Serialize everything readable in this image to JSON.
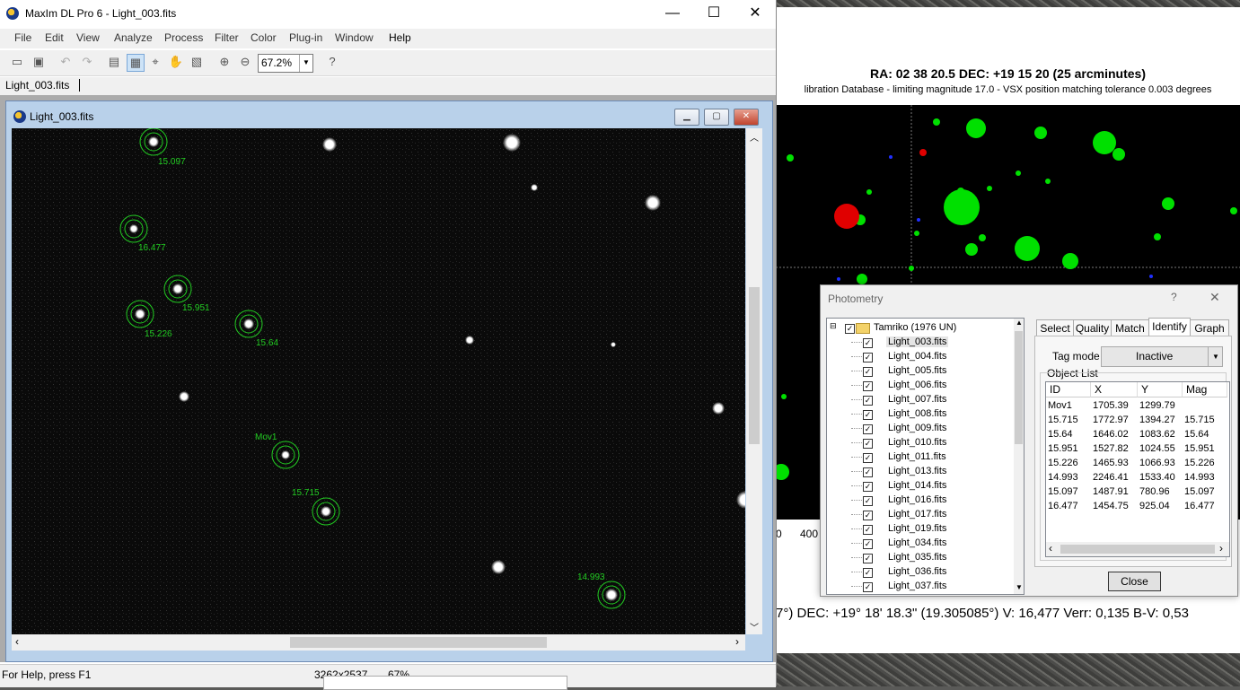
{
  "main": {
    "title": "MaxIm DL Pro 6 - Light_003.fits",
    "controls": {
      "minimize": "—",
      "maximize": "☐",
      "close": "✕"
    },
    "menu": [
      "File",
      "Edit",
      "View",
      "Analyze",
      "Process",
      "Filter",
      "Color",
      "Plug-in",
      "Window",
      "Help"
    ],
    "zoom": "67.2%",
    "doc_tab": "Light_003.fits"
  },
  "image_window": {
    "title": "Light_003.fits",
    "labels": [
      {
        "text": "15.097"
      },
      {
        "text": "16.477"
      },
      {
        "text": "15.951"
      },
      {
        "text": "15.226"
      },
      {
        "text": "15.64"
      },
      {
        "text": "Mov1"
      },
      {
        "text": "15.715"
      },
      {
        "text": "14.993"
      }
    ]
  },
  "status": {
    "help": "For Help, press F1",
    "dims": "3262x2537",
    "zoom": "67%"
  },
  "chart": {
    "title": "RA: 02 38 20.5   DEC: +19 15 20 (25 arcminutes)",
    "subtitle": "libration Database - limiting magnitude 17.0 - VSX position matching tolerance 0.003 degrees",
    "axis_labels": [
      "0",
      "400"
    ],
    "readout": "7°)   DEC: +19° 18' 18.3\" (19.305085°)   V: 16,477   Verr: 0,135   B-V: 0,53"
  },
  "photometry": {
    "title": "Photometry",
    "help_btn": "?",
    "close_x": "✕",
    "tree_root": "Tamriko (1976 UN)",
    "files": [
      "Light_003.fits",
      "Light_004.fits",
      "Light_005.fits",
      "Light_006.fits",
      "Light_007.fits",
      "Light_008.fits",
      "Light_009.fits",
      "Light_010.fits",
      "Light_011.fits",
      "Light_013.fits",
      "Light_014.fits",
      "Light_016.fits",
      "Light_017.fits",
      "Light_019.fits",
      "Light_034.fits",
      "Light_035.fits",
      "Light_036.fits",
      "Light_037.fits"
    ],
    "tabs": [
      "Select",
      "Quality",
      "Match",
      "Identify",
      "Graph"
    ],
    "tag_mode_label": "Tag mode",
    "tag_mode_value": "Inactive",
    "object_list_label": "Object List",
    "columns": [
      "ID",
      "X",
      "Y",
      "Mag"
    ],
    "rows": [
      [
        "Mov1",
        "1705.39",
        "1299.79",
        ""
      ],
      [
        "15.715",
        "1772.97",
        "1394.27",
        "15.715"
      ],
      [
        "15.64",
        "1646.02",
        "1083.62",
        "15.64"
      ],
      [
        "15.951",
        "1527.82",
        "1024.55",
        "15.951"
      ],
      [
        "15.226",
        "1465.93",
        "1066.93",
        "15.226"
      ],
      [
        "14.993",
        "2246.41",
        "1533.40",
        "14.993"
      ],
      [
        "15.097",
        "1487.91",
        "780.96",
        "15.097"
      ],
      [
        "16.477",
        "1454.75",
        "925.04",
        "16.477"
      ]
    ],
    "close_btn": "Close"
  }
}
